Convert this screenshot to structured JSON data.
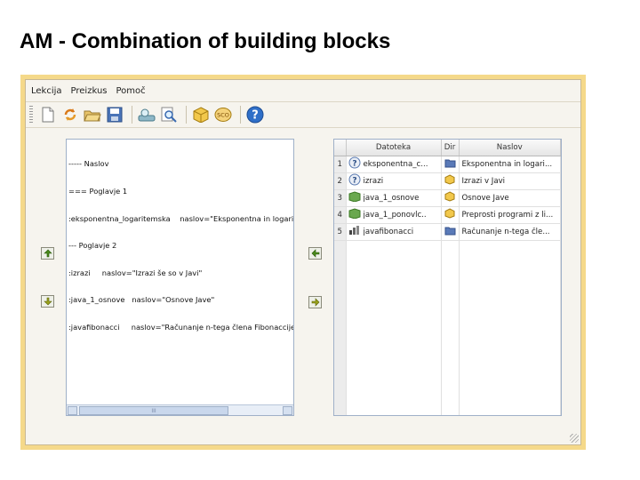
{
  "slide": {
    "title": "AM - Combination of building blocks"
  },
  "menu": {
    "items": [
      "Lekcija",
      "Preizkus",
      "Pomoč"
    ]
  },
  "toolbar": {
    "icons": [
      "new-file-icon",
      "refresh-icon",
      "open-folder-icon",
      "save-icon",
      "preview-icon",
      "zoom-icon",
      "package-icon",
      "sco-icon",
      "help-icon"
    ],
    "sco_label": "SCO",
    "help_label": "?"
  },
  "left_pane": {
    "lines": [
      "----- Naslov",
      "=== Poglavje 1",
      ":eksponentna_logaritemska    naslov=\"Eksponentna in logaritem",
      "--- Poglavje 2",
      ":izrazi     naslov=\"Izrazi še so v Javi\"",
      ":java_1_osnove   naslov=\"Osnove Jave\"",
      ":javafibonacci     naslov=\"Računanje n-tega člena Fibonaccijeve"
    ],
    "scroll_mark": "III"
  },
  "right_pane": {
    "columns": [
      "",
      "Datoteka",
      "Dir",
      "Naslov"
    ],
    "rows": [
      {
        "num": "1",
        "file_icon": "question-icon",
        "file": "eksponentna_c...",
        "dir_icon": "folder-icon",
        "title": "Eksponentna in logari..."
      },
      {
        "num": "2",
        "file_icon": "question-icon",
        "file": "izrazi",
        "dir_icon": "box-icon",
        "title": "Izrazi v Javi"
      },
      {
        "num": "3",
        "file_icon": "green-block-icon",
        "file": "java_1_osnove",
        "dir_icon": "box-icon",
        "title": "Osnove Jave"
      },
      {
        "num": "4",
        "file_icon": "green-block-icon",
        "file": "java_1_ponovlc..",
        "dir_icon": "box-icon",
        "title": "Preprosti programi z li..."
      },
      {
        "num": "5",
        "file_icon": "chart-icon",
        "file": "javafibonacci",
        "dir_icon": "folder-icon",
        "title": "Računanje n-tega čle..."
      }
    ]
  },
  "side_buttons": [
    "move-up-button",
    "move-down-button",
    "move-left-button",
    "move-right-button"
  ]
}
